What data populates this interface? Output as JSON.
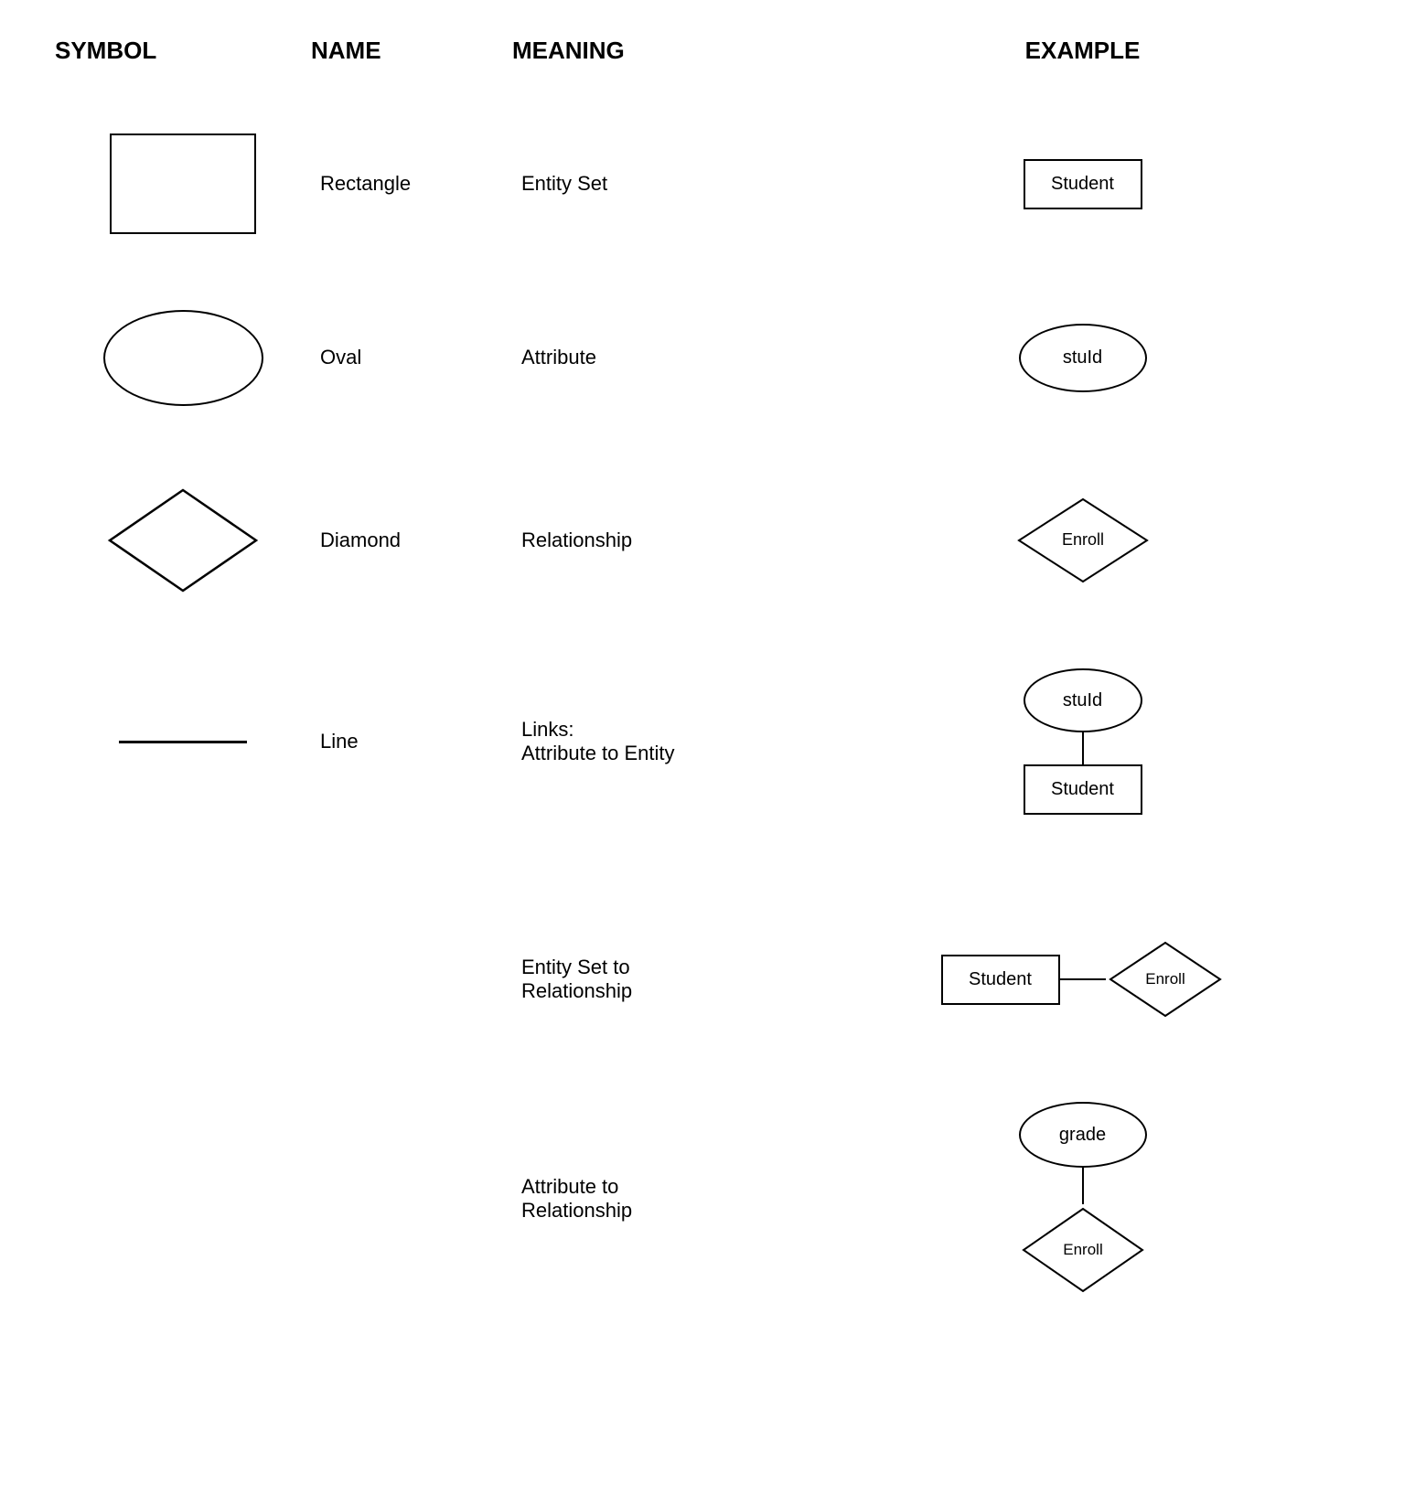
{
  "header": {
    "symbol": "SYMBOL",
    "name": "NAME",
    "meaning": "MEANING",
    "example": "EXAMPLE"
  },
  "rows": [
    {
      "id": "rectangle",
      "name": "Rectangle",
      "meaning": "Entity Set",
      "example_label": "Student",
      "example_shape": "rectangle"
    },
    {
      "id": "oval",
      "name": "Oval",
      "meaning": "Attribute",
      "example_label": "stuId",
      "example_shape": "oval"
    },
    {
      "id": "diamond",
      "name": "Diamond",
      "meaning": "Relationship",
      "example_label": "Enroll",
      "example_shape": "diamond"
    },
    {
      "id": "line",
      "name": "Line",
      "meaning_line1": "Links:",
      "meaning_line2": "Attribute to Entity",
      "example_shape": "line-example",
      "ex_oval_label": "stuId",
      "ex_rect_label": "Student"
    }
  ],
  "extra_rows": [
    {
      "id": "entity-set-to-relationship",
      "meaning_line1": "Entity Set to",
      "meaning_line2": "Relationship",
      "example_shape": "entity-rel",
      "ex_rect_label": "Student",
      "ex_diamond_label": "Enroll"
    },
    {
      "id": "attribute-to-relationship",
      "meaning_line1": "Attribute to",
      "meaning_line2": "Relationship",
      "example_shape": "attr-rel",
      "ex_oval_label": "grade",
      "ex_diamond_label": "Enroll"
    }
  ]
}
